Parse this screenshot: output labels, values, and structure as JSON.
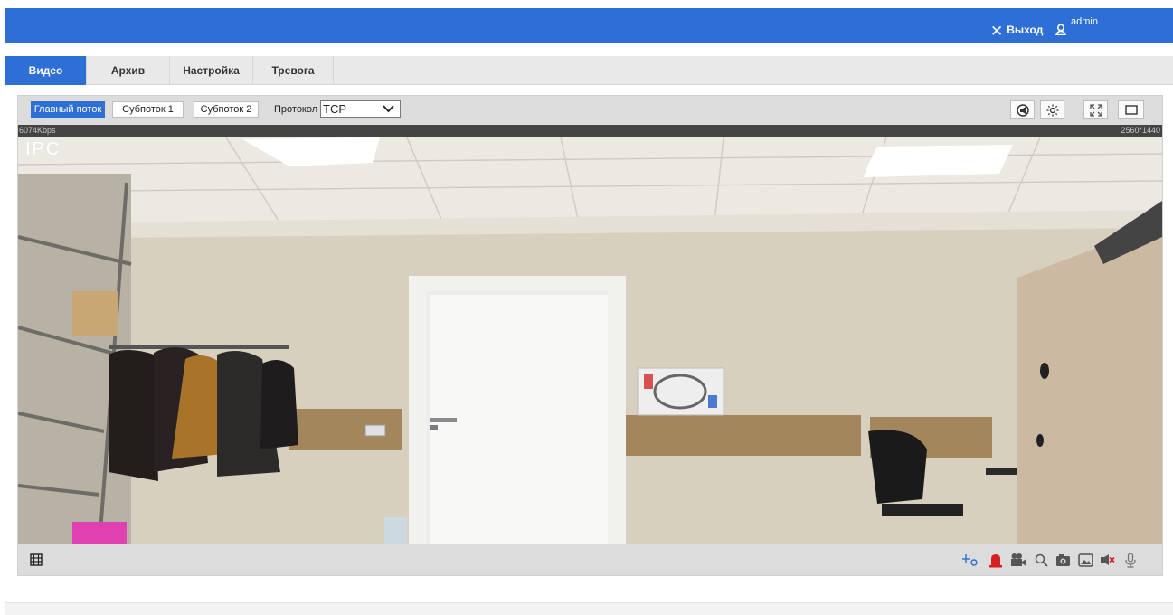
{
  "header": {
    "logout_label": "Выход",
    "username": "admin",
    "close_glyph": "✕"
  },
  "tabs": [
    {
      "label": "Видео",
      "active": true
    },
    {
      "label": "Архив",
      "active": false
    },
    {
      "label": "Настройка",
      "active": false
    },
    {
      "label": "Тревога",
      "active": false
    }
  ],
  "stream": {
    "main_label": "Главный поток",
    "sub1_label": "Субпоток 1",
    "sub2_label": "Субпоток 2",
    "protocol_label": "Протокол",
    "protocol_value": "TCP"
  },
  "video": {
    "bitrate": "6074Kbps",
    "resolution": "2560*1440",
    "osd_text": "IPC"
  },
  "icons": {
    "top_right": [
      "speaker-icon",
      "brightness-icon",
      "fullscreen-icon",
      "window-icon"
    ],
    "bottom_left": [
      "film-icon"
    ],
    "bottom_right": [
      "ptz-icon",
      "alarm-icon",
      "record-icon",
      "zoom-icon",
      "snapshot-icon",
      "image-icon",
      "audio-mute-icon",
      "microphone-icon"
    ]
  },
  "colors": {
    "accent": "#2e6fd6",
    "alarm": "#d62020"
  }
}
